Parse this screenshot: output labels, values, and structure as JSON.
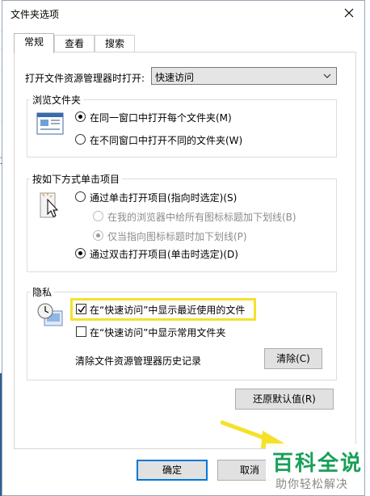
{
  "window": {
    "title": "文件夹选项"
  },
  "tabs": [
    {
      "label": "常规",
      "active": true
    },
    {
      "label": "查看",
      "active": false
    },
    {
      "label": "搜索",
      "active": false
    }
  ],
  "open_explorer": {
    "label": "打开文件资源管理器时打开:",
    "value": "快速访问"
  },
  "browse_folders": {
    "title": "浏览文件夹",
    "options": [
      {
        "label": "在同一窗口中打开每个文件夹(M)",
        "selected": true
      },
      {
        "label": "在不同窗口中打开不同的文件夹(W)",
        "selected": false
      }
    ]
  },
  "click_items": {
    "title": "按如下方式单击项目",
    "options": [
      {
        "label": "通过单击打开项目(指向时选定)(S)",
        "selected": false
      },
      {
        "label": "在我的浏览器中给所有图标标题加下划线(B)",
        "selected": false,
        "disabled": true
      },
      {
        "label": "仅当指向图标标题时加下划线(P)",
        "selected": true,
        "disabled": true
      },
      {
        "label": "通过双击打开项目(单击时选定)(D)",
        "selected": true
      }
    ]
  },
  "privacy": {
    "title": "隐私",
    "checkboxes": [
      {
        "label": "在“快速访问”中显示最近使用的文件",
        "checked": true
      },
      {
        "label": "在“快速访问”中显示常用文件夹",
        "checked": false
      }
    ],
    "clear_label": "清除文件资源管理器历史记录",
    "clear_button": "清除(C)"
  },
  "restore_defaults": "还原默认值(R)",
  "footer": {
    "ok": "确定",
    "cancel": "取消"
  },
  "background": {
    "glyphs": [
      "文"
    ]
  },
  "watermark": {
    "title": "百科全说",
    "subtitle": "助你轻松解决"
  },
  "colors": {
    "accent": "#0078d7",
    "highlight": "#f5e12b",
    "watermark": "#18a058"
  },
  "icons": [
    "close-icon",
    "chevron-down-icon",
    "folder-window-icon",
    "click-cursor-icon",
    "privacy-clock-icon",
    "checkmark-icon",
    "arrow-annotation-icon"
  ]
}
